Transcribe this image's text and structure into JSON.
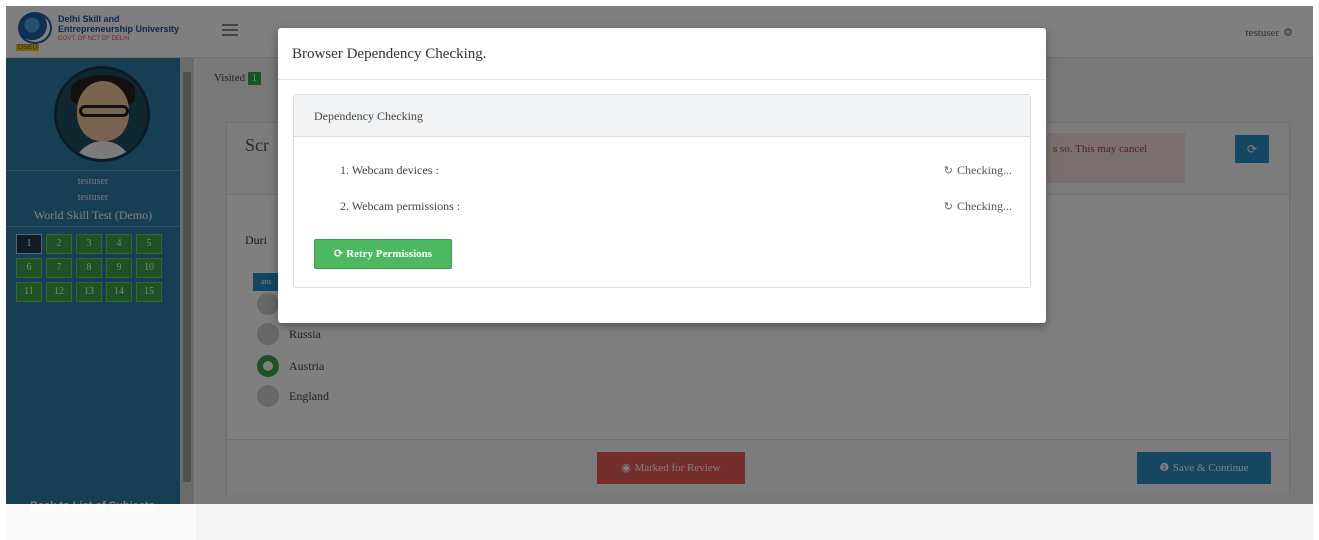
{
  "header": {
    "logo_line1": "Delhi Skill and",
    "logo_line2": "Entrepreneurship University",
    "logo_tag": "GOVT. OF NCT OF DELHI",
    "logo_abbr": "DSEU",
    "username": "testuser"
  },
  "sidebar": {
    "name1": "testuser",
    "name2": "testuser",
    "test_name": "World Skill Test (Demo)",
    "questions": [
      "1",
      "2",
      "3",
      "4",
      "5",
      "6",
      "7",
      "8",
      "9",
      "10",
      "11",
      "12",
      "13",
      "14",
      "15"
    ],
    "current_question": "1",
    "back_link": "Back to List of Subjects"
  },
  "main": {
    "visited_label": "Visited",
    "visited_count": "1",
    "section_title": "Scr",
    "alert_text": "s so. This may cancel",
    "question_prefix": "Duri",
    "options": [
      {
        "label": "",
        "checked": false
      },
      {
        "label": "Russia",
        "checked": false
      },
      {
        "label": "Austria",
        "checked": true
      },
      {
        "label": "England",
        "checked": false
      }
    ],
    "marked_for_review": "Marked for Review",
    "save_continue": "Save & Continue"
  },
  "modal": {
    "title": "Browser Dependency Checking.",
    "panel_heading": "Dependency Checking",
    "checks": [
      {
        "label": "1. Webcam devices :",
        "status": "Checking..."
      },
      {
        "label": "2. Webcam permissions :",
        "status": "Checking..."
      }
    ],
    "retry_label": "Retry Permissions"
  },
  "colors": {
    "sidebar": "#2f7fa6",
    "success": "#4cb862",
    "danger": "#e85c58",
    "primary": "#2a8fc4"
  },
  "icons": [
    "hamburger-icon",
    "gear-icon",
    "refresh-icon",
    "spinner-icon",
    "eye-icon",
    "info-icon"
  ]
}
